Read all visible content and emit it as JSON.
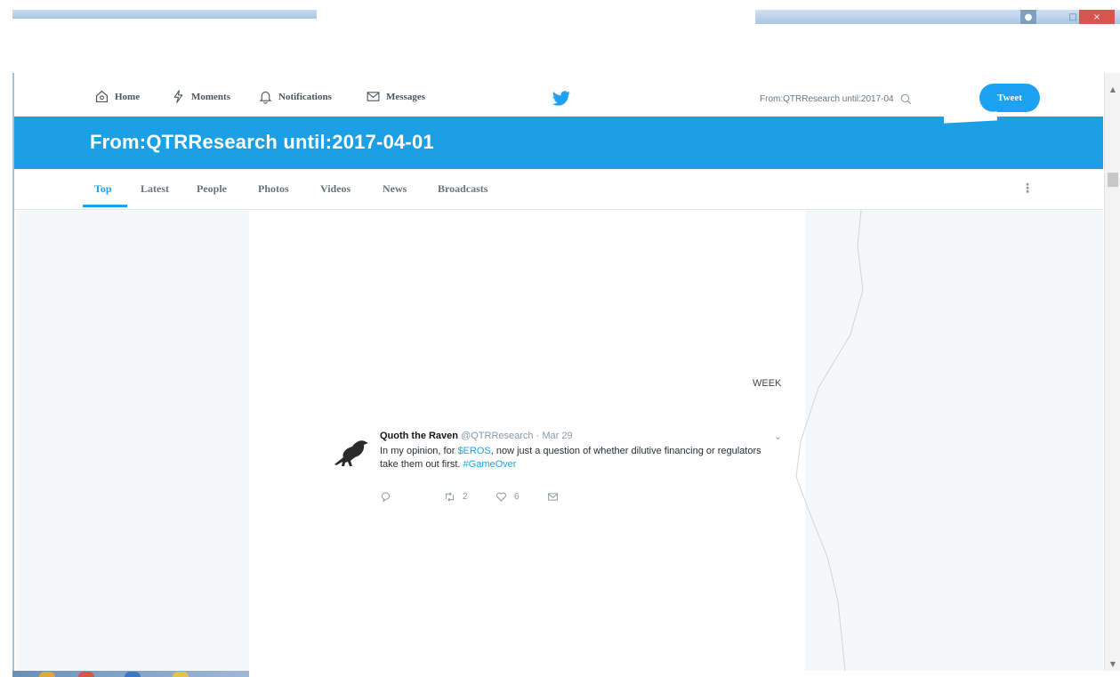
{
  "window": {
    "user_icon": "user-icon",
    "maximize_icon": "maximize-icon",
    "close_icon": "close-icon",
    "close_symbol": "×",
    "maximize_symbol": "□",
    "scroll_up": "▲",
    "scroll_down": "▼"
  },
  "nav": {
    "home": "Home",
    "moments": "Moments",
    "notifications": "Notifications",
    "messages": "Messages",
    "search_value": "From:QTRResearch until:2017-04",
    "tweet_button": "Tweet"
  },
  "banner": {
    "title": "From:QTRResearch until:2017-04-01"
  },
  "tabs": [
    {
      "label": "Top",
      "active": true
    },
    {
      "label": "Latest"
    },
    {
      "label": "People"
    },
    {
      "label": "Photos"
    },
    {
      "label": "Videos"
    },
    {
      "label": "News"
    },
    {
      "label": "Broadcasts"
    }
  ],
  "more_symbol": "⋮",
  "section": {
    "week_label": "WEEK"
  },
  "tweet": {
    "name": "Quoth the Raven",
    "handle": "@QTRResearch",
    "separator": " · ",
    "date": "Mar 29",
    "chevron": "⌄",
    "text_part1": "In my opinion, for ",
    "cashtag": "$EROS",
    "text_part2": ", now just a question of whether dilutive financing or regulators take them out first. ",
    "hashtag": "#GameOver",
    "retweets": "2",
    "likes": "6"
  },
  "colors": {
    "brand": "#1da1f2",
    "banner": "#1b9fe5",
    "muted": "#8899a6"
  }
}
